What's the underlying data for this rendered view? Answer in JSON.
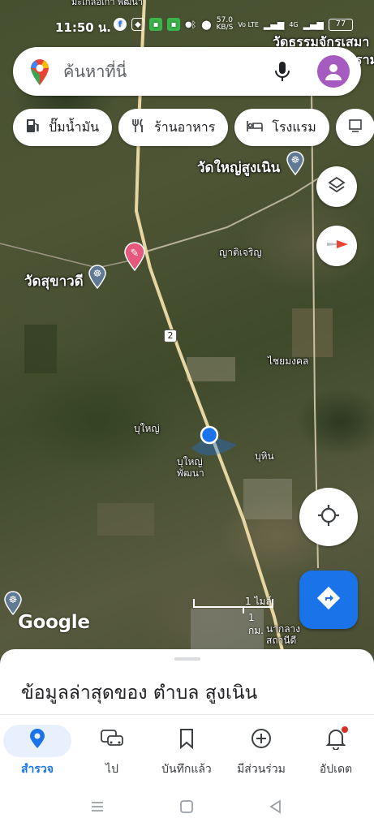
{
  "status_bar": {
    "time": "11:50 น.",
    "network_speed_value": "57.0",
    "network_speed_unit": "KB/S",
    "volte": "Vo LTE",
    "lte_label": "4G",
    "battery": "77"
  },
  "search": {
    "placeholder": "ค้นหาที่นี่"
  },
  "chips": [
    {
      "label": "ปั๊มน้ำมัน",
      "icon": "gas-station-icon"
    },
    {
      "label": "ร้านอาหาร",
      "icon": "restaurant-icon"
    },
    {
      "label": "โรงแรม",
      "icon": "hotel-icon"
    }
  ],
  "map_labels": {
    "top_partial": "มะเกลือเก่า พัฒนา",
    "temple_top_right": "วัดธรรมจักรเสมา",
    "temple_top_right_suffix": "ราม",
    "temple_sung_noen": "วัดใหญ่สูงเนิน",
    "yat_charoen": "ญาติเจริญ",
    "temple_sukhawadee": "วัดสุขาวดี",
    "route_number": "2",
    "chai_mongkhon": "ไชยมงคล",
    "bu_yai": "บุใหญ่",
    "bu_yai_phatthana": "บุใหญ่ พัฒนา",
    "bu_hin": "บุหิน",
    "nakhlang_station": "นากลาง สถานีดี"
  },
  "scale": {
    "miles": "1 ไมล์",
    "km": "1 กม."
  },
  "google_logo": "Google",
  "sheet": {
    "title": "ข้อมูลล่าสุดของ ตำบล สูงเนิน"
  },
  "bottom_nav": [
    {
      "label": "สำรวจ",
      "icon": "explore-pin-icon",
      "active": true
    },
    {
      "label": "ไป",
      "icon": "commute-car-icon",
      "active": false
    },
    {
      "label": "บันทึกแล้ว",
      "icon": "bookmark-icon",
      "active": false
    },
    {
      "label": "มีส่วนร่วม",
      "icon": "add-circle-icon",
      "active": false
    },
    {
      "label": "อัปเดต",
      "icon": "bell-icon",
      "active": false
    }
  ],
  "colors": {
    "accent": "#1a73e8",
    "avatar": "#a55bbf",
    "road": "#e7d6a1",
    "location_dot": "#1a73e8",
    "pin": "#e5577b"
  }
}
